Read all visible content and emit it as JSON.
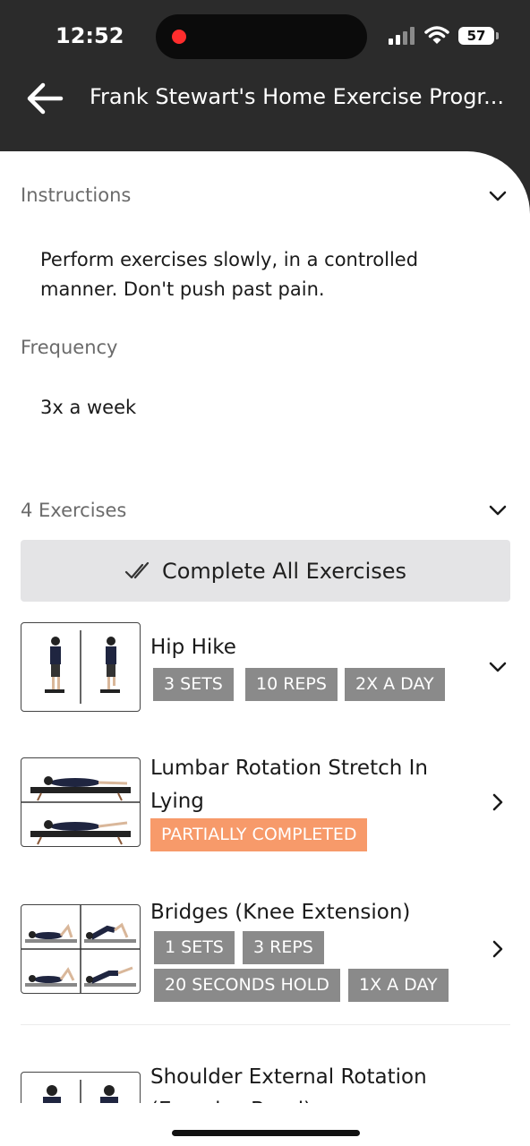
{
  "status_bar": {
    "time": "12:52",
    "battery": "57"
  },
  "header": {
    "title": "Frank Stewart's Home Exercise Progr..."
  },
  "instructions": {
    "heading": "Instructions",
    "text": "Perform exercises slowly, in a controlled manner. Don't push past pain."
  },
  "frequency": {
    "heading": "Frequency",
    "text": "3x a week"
  },
  "exercises_section": {
    "heading": "4 Exercises",
    "complete_all_label": "Complete All Exercises"
  },
  "exercises": [
    {
      "name": "Hip Hike",
      "tags": [
        "3 SETS",
        "10 REPS",
        "2X A DAY"
      ]
    },
    {
      "name": "Lumbar Rotation Stretch In Lying",
      "status": "PARTIALLY COMPLETED"
    },
    {
      "name": "Bridges (Knee Extension)",
      "tags": [
        "1 SETS",
        "3 REPS",
        "20 SECONDS HOLD",
        "1X A DAY"
      ]
    },
    {
      "name": "Shoulder External Rotation (Exercise Band)"
    }
  ],
  "colors": {
    "header_bg": "#2b2b2b",
    "tag_gray": "#8a8a8a",
    "status_orange": "#f79a6a",
    "button_bg": "#e4e4e6"
  }
}
